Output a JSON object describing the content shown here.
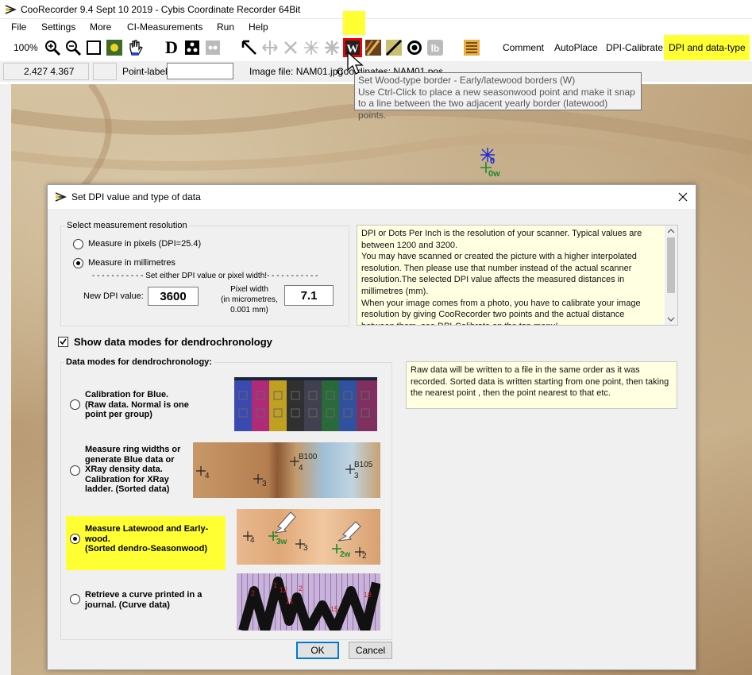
{
  "app": {
    "title": "CooRecorder 9.4 Sept 10 2019 - Cybis Coordinate Recorder  64Bit"
  },
  "menu": [
    "File",
    "Settings",
    "More",
    "CI-Measurements",
    "Run",
    "Help"
  ],
  "toolbar": {
    "zoom": "100%",
    "comment": "Comment",
    "autoplace": "AutoPlace",
    "dpi_calibrate": "DPI-Calibrate",
    "dpi_data_type": "DPI and data-type",
    "highlight_color": "#ffff33"
  },
  "status": {
    "coords": "2.427  4.367",
    "point_label": "Point-label:",
    "point_label_value": "",
    "image_file": "Image file: NAM01.jpg",
    "coord_file": "Coordinates: NAM01.pos"
  },
  "tooltip": {
    "line1": "Set Wood-type border - Early/latewood borders (W)",
    "line2": "Use Ctrl-Click to place a new seasonwood point and make it snap",
    "line3": "to a line between the two adjacent yearly border (latewood) points."
  },
  "markers": {
    "m0": "0",
    "m0w": "0w"
  },
  "dialog": {
    "title": "Set DPI value and type of data",
    "resolution_group": "Select measurement resolution",
    "measure_pixels": "Measure in pixels (DPI=25.4)",
    "measure_mm": "Measure in millimetres",
    "set_either": "- - - - - - - - - - - Set either DPI value or pixel width!- - - - - - - - - - -",
    "new_dpi_label": "New DPI value:",
    "dpi_value": "3600",
    "pixel_width_label1": "Pixel width",
    "pixel_width_label2": "(in micrometres,",
    "pixel_width_label3": "0.001 mm)",
    "pixel_width_value": "7.1",
    "dpi_info": "DPI or Dots Per Inch is the resolution of your scanner. Typical values are between 1200 and 3200.\nYou may have scanned or created the picture with a higher interpolated resolution. Then please use that number instead of the actual scanner resolution.The selected DPI value affects the measured distances in millimetres (mm).\nWhen your image comes from a photo, you have to calibrate your image resolution by giving CooRecorder two points and the actual distance between them, see DPI-Calibrate on the top menu!",
    "show_modes": "Show data modes for dendrochronology",
    "modes_group": "Data modes for dendrochronology:",
    "mode_info": "Raw data will be written to a file in the same order as it was recorded. Sorted data is written starting from one point, then taking the nearest point , then the point nearest to that etc.",
    "modes": [
      {
        "label": "Calibration for Blue.\n(Raw data. Normal is one\npoint per group)",
        "selected": false
      },
      {
        "label": "Measure ring widths or\ngenerate Blue data or\nXRay density data.\nCalibration for XRay\nladder. (Sorted data)",
        "selected": false
      },
      {
        "label": "Measure Latewood and Early-\nwood.\n(Sorted dendro-Seasonwood)",
        "selected": true
      },
      {
        "label": "Retrieve a curve printed in a\njournal. (Curve data)",
        "selected": false
      }
    ],
    "thumb2_labels": [
      "4",
      "3",
      "B100",
      "4",
      "B105",
      "3"
    ],
    "thumb3_labels": [
      "4",
      "3w",
      "3",
      "2w",
      "2"
    ],
    "thumb4_labels": [
      "2",
      "1",
      "12",
      "11",
      "2",
      "15",
      "18"
    ],
    "ok": "OK",
    "cancel": "Cancel"
  }
}
